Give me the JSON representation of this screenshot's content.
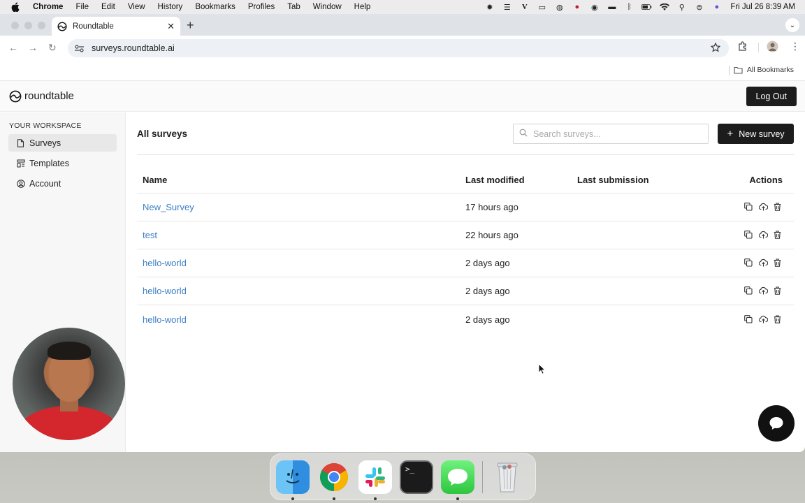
{
  "menubar": {
    "app": "Chrome",
    "items": [
      "File",
      "Edit",
      "View",
      "History",
      "Bookmarks",
      "Profiles",
      "Tab",
      "Window",
      "Help"
    ],
    "clock": "Fri Jul 26  8:39 AM"
  },
  "browser": {
    "tab_title": "Roundtable",
    "url": "surveys.roundtable.ai",
    "all_bookmarks": "All Bookmarks"
  },
  "app": {
    "logo_text": "roundtable",
    "logout_label": "Log Out"
  },
  "sidebar": {
    "section_label": "YOUR WORKSPACE",
    "items": [
      {
        "label": "Surveys",
        "icon": "document-icon",
        "active": true
      },
      {
        "label": "Templates",
        "icon": "template-icon",
        "active": false
      },
      {
        "label": "Account",
        "icon": "user-circle-icon",
        "active": false
      }
    ]
  },
  "main": {
    "title": "All surveys",
    "search_placeholder": "Search surveys...",
    "new_survey_label": "New survey",
    "columns": {
      "name": "Name",
      "modified": "Last modified",
      "submission": "Last submission",
      "actions": "Actions"
    },
    "rows": [
      {
        "name": "New_Survey",
        "modified": "17 hours ago",
        "submission": ""
      },
      {
        "name": "test",
        "modified": "22 hours ago",
        "submission": ""
      },
      {
        "name": "hello-world",
        "modified": "2 days ago",
        "submission": ""
      },
      {
        "name": "hello-world",
        "modified": "2 days ago",
        "submission": ""
      },
      {
        "name": "hello-world",
        "modified": "2 days ago",
        "submission": ""
      }
    ]
  },
  "colors": {
    "link": "#3b7fc4",
    "button_dark": "#1c1c1c",
    "sidebar_bg": "#f7f7f7"
  },
  "dock": {
    "apps": [
      "finder-icon",
      "chrome-icon",
      "slack-icon",
      "terminal-icon",
      "messages-icon",
      "trash-icon"
    ]
  }
}
